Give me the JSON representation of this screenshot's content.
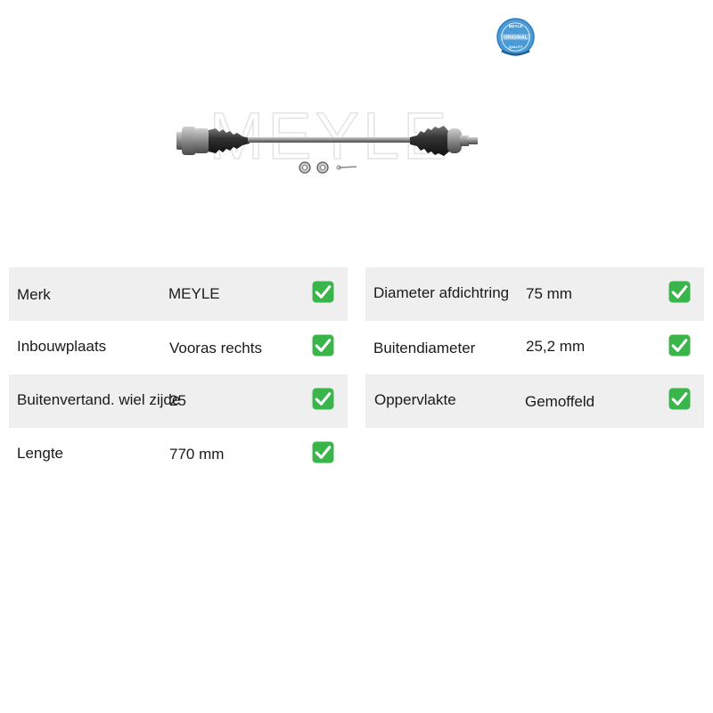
{
  "brand": {
    "logo_text": "MEYLE",
    "badge_top": "MEYLE",
    "badge_middle": "ORIGINAL",
    "badge_bottom": "QUALITY"
  },
  "product": {
    "image": "drive-shaft",
    "watermark": "MEYLE"
  },
  "colors": {
    "row_shade": "#efefef",
    "check_green": "#3ab54a",
    "badge_blue": "#4a9bd6"
  },
  "check_icon": "white-check-mark-on-green",
  "specs_left": [
    {
      "label": "Merk",
      "value": "MEYLE",
      "checked": true
    },
    {
      "label": "Inbouwplaats",
      "value": "Vooras rechts",
      "checked": true
    },
    {
      "label": "Buitenvertand. wiel zijde",
      "value": "25",
      "checked": true
    },
    {
      "label": "Lengte",
      "value": "770 mm",
      "checked": true
    }
  ],
  "specs_right": [
    {
      "label": "Diameter afdichtring",
      "value": "75 mm",
      "checked": true
    },
    {
      "label": "Buitendiameter",
      "value": "25,2 mm",
      "checked": true
    },
    {
      "label": "Oppervlakte",
      "value": "Gemoffeld",
      "checked": true
    }
  ]
}
